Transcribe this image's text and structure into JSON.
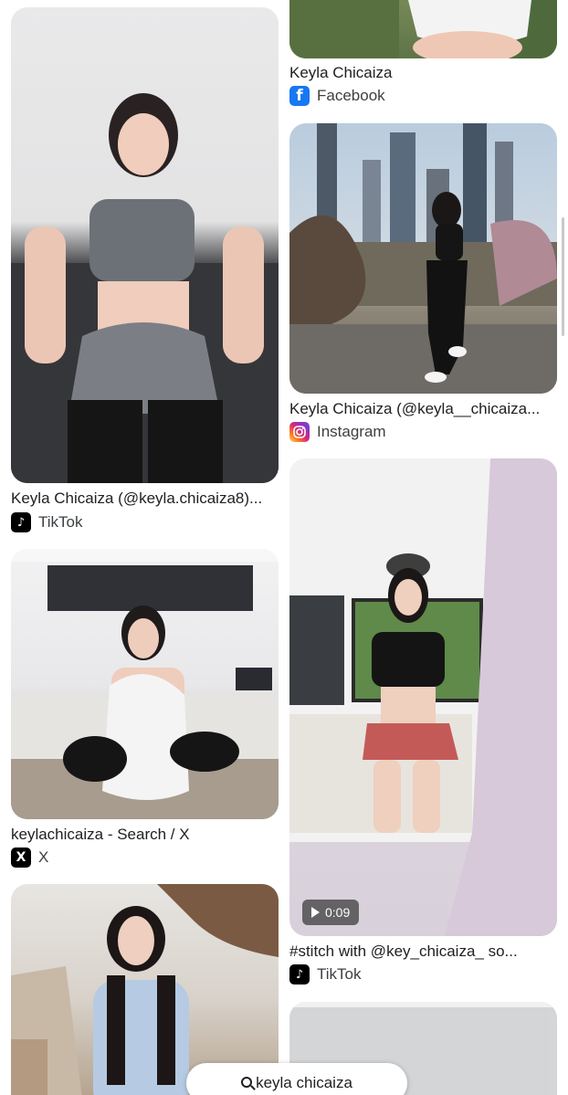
{
  "results": [
    {
      "title": "Keyla Chicaiza (@keyla.chicaiza8)...",
      "source": "TikTok",
      "source_icon": "tiktok-icon"
    },
    {
      "title": "keylachicaiza - Search / X",
      "source": "X",
      "source_icon": "x-icon"
    },
    {
      "title": "Keyla Chicaiza",
      "source": "Facebook",
      "source_icon": "facebook-icon"
    },
    {
      "title": "Keyla Chicaiza (@keyla__chicaiza...",
      "source": "Instagram",
      "source_icon": "instagram-icon"
    },
    {
      "title": "#stitch with @key_chicaiza_ so...",
      "source": "TikTok",
      "source_icon": "tiktok-icon",
      "duration": "0:09"
    }
  ],
  "search": {
    "query": "keyla chicaiza"
  },
  "icon_glyphs": {
    "facebook": "f",
    "tiktok": "♪",
    "x": "X"
  },
  "colors": {
    "facebook": "#1877f2",
    "tiktok": "#000000",
    "x": "#000000"
  }
}
